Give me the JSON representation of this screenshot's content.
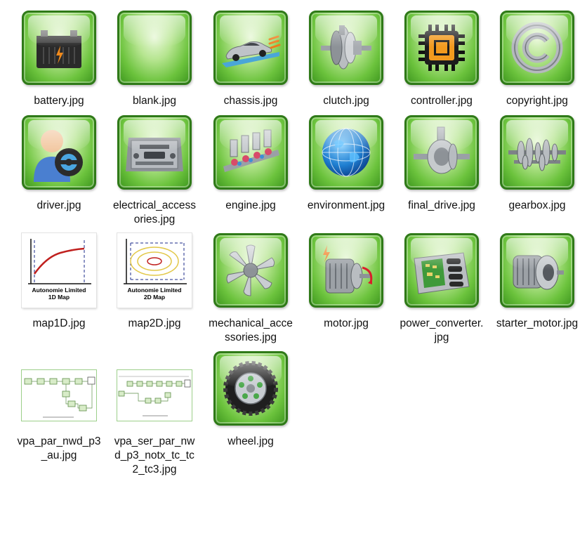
{
  "files": [
    {
      "name": "battery.jpg",
      "icon": "battery-icon"
    },
    {
      "name": "blank.jpg",
      "icon": "blank-icon"
    },
    {
      "name": "chassis.jpg",
      "icon": "chassis-icon"
    },
    {
      "name": "clutch.jpg",
      "icon": "clutch-icon"
    },
    {
      "name": "controller.jpg",
      "icon": "controller-icon"
    },
    {
      "name": "copyright.jpg",
      "icon": "copyright-icon"
    },
    {
      "name": "driver.jpg",
      "icon": "driver-icon"
    },
    {
      "name": "electrical_accessories.jpg",
      "icon": "electrical-accessories-icon"
    },
    {
      "name": "engine.jpg",
      "icon": "engine-icon"
    },
    {
      "name": "environment.jpg",
      "icon": "environment-icon"
    },
    {
      "name": "final_drive.jpg",
      "icon": "final-drive-icon"
    },
    {
      "name": "gearbox.jpg",
      "icon": "gearbox-icon"
    },
    {
      "name": "map1D.jpg",
      "icon": "map1d-icon",
      "caption": [
        "Autonomie Limited",
        "1D Map"
      ]
    },
    {
      "name": "map2D.jpg",
      "icon": "map2d-icon",
      "caption": [
        "Autonomie Limited",
        "2D Map"
      ]
    },
    {
      "name": "mechanical_accessories.jpg",
      "icon": "mechanical-accessories-icon"
    },
    {
      "name": "motor.jpg",
      "icon": "motor-icon"
    },
    {
      "name": "power_converter.jpg",
      "icon": "power-converter-icon"
    },
    {
      "name": "starter_motor.jpg",
      "icon": "starter-motor-icon"
    },
    {
      "name": "vpa_par_nwd_p3_au.jpg",
      "icon": "diagram-icon"
    },
    {
      "name": "vpa_ser_par_nwd_p3_notx_tc_tc2_tc3.jpg",
      "icon": "diagram-icon"
    },
    {
      "name": "wheel.jpg",
      "icon": "wheel-icon"
    }
  ],
  "colors": {
    "tile_green": "#6cc33d",
    "tile_border": "#2f7a18",
    "map_curve": "#c0211f",
    "map_axis_dash": "#1a2a8a",
    "map_contour": "#e2c84a"
  }
}
